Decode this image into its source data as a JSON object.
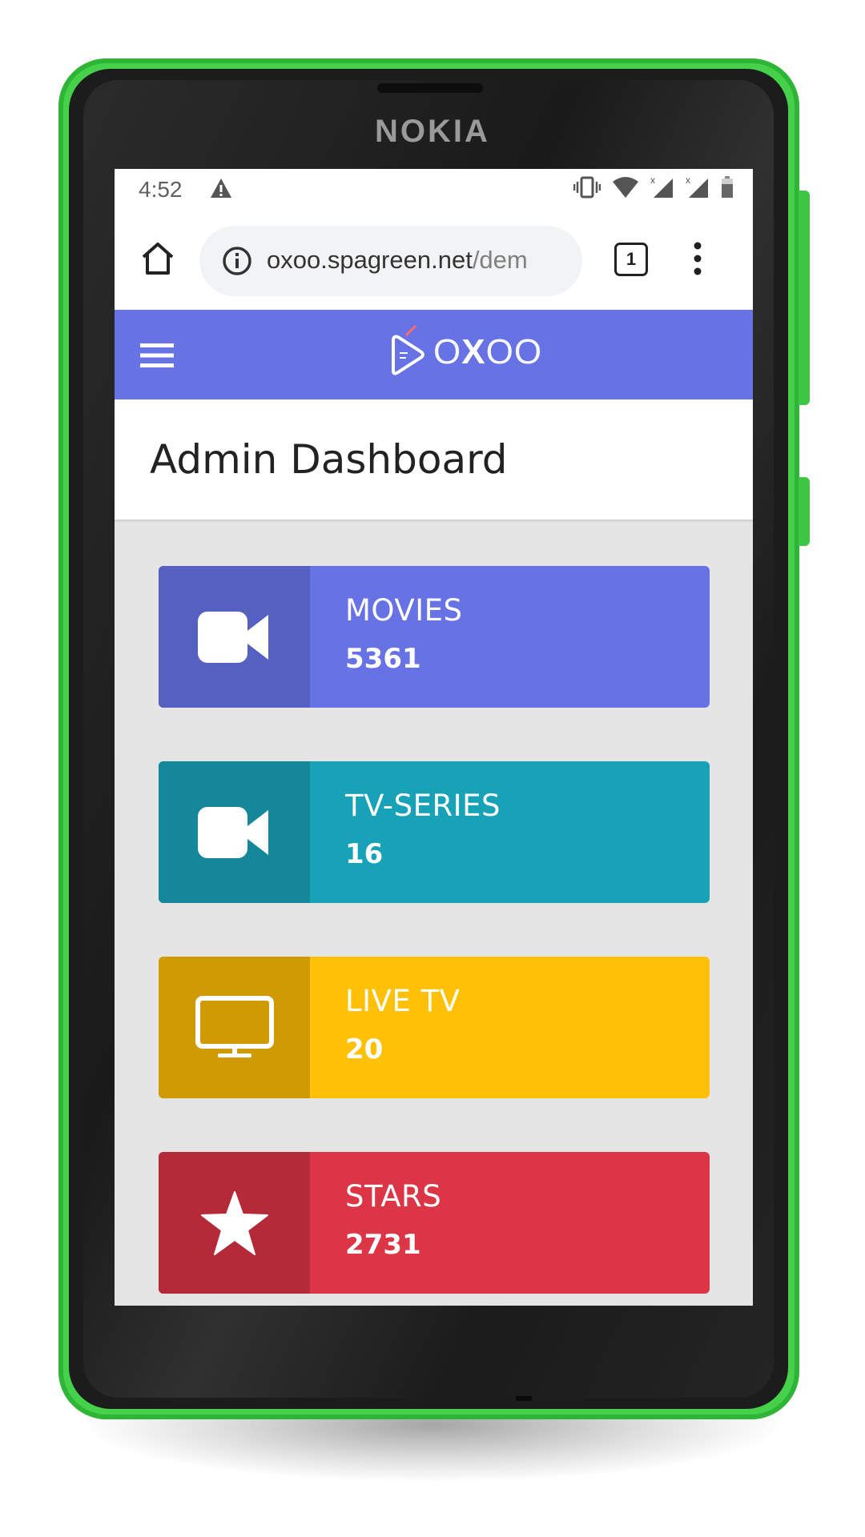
{
  "device": {
    "brand": "NOKIA",
    "body_color": "#45d14a"
  },
  "status_bar": {
    "time": "4:52",
    "icons": [
      "warning-icon",
      "vibrate-icon",
      "wifi-icon",
      "signal-icon",
      "signal-icon",
      "battery-icon"
    ]
  },
  "browser": {
    "url_domain": "oxoo.spagreen.net",
    "url_path": "/dem",
    "tab_count": "1"
  },
  "app_bar": {
    "color": "#6772e5",
    "logo_text": {
      "o1": "O",
      "x": "X",
      "o2": "OO"
    }
  },
  "page": {
    "title": "Admin Dashboard"
  },
  "cards": [
    {
      "label": "MOVIES",
      "value": "5361",
      "icon": "video-camera-icon",
      "color": "#6772e5",
      "icon_bg": "#5660c1"
    },
    {
      "label": "TV-SERIES",
      "value": "16",
      "icon": "video-camera-icon",
      "color": "#17a2b8",
      "icon_bg": "#14879a"
    },
    {
      "label": "LIVE TV",
      "value": "20",
      "icon": "monitor-icon",
      "color": "#ffc107",
      "icon_bg": "#d09a05"
    },
    {
      "label": "STARS",
      "value": "2731",
      "icon": "star-icon",
      "color": "#dc3545",
      "icon_bg": "#b52a38"
    }
  ]
}
